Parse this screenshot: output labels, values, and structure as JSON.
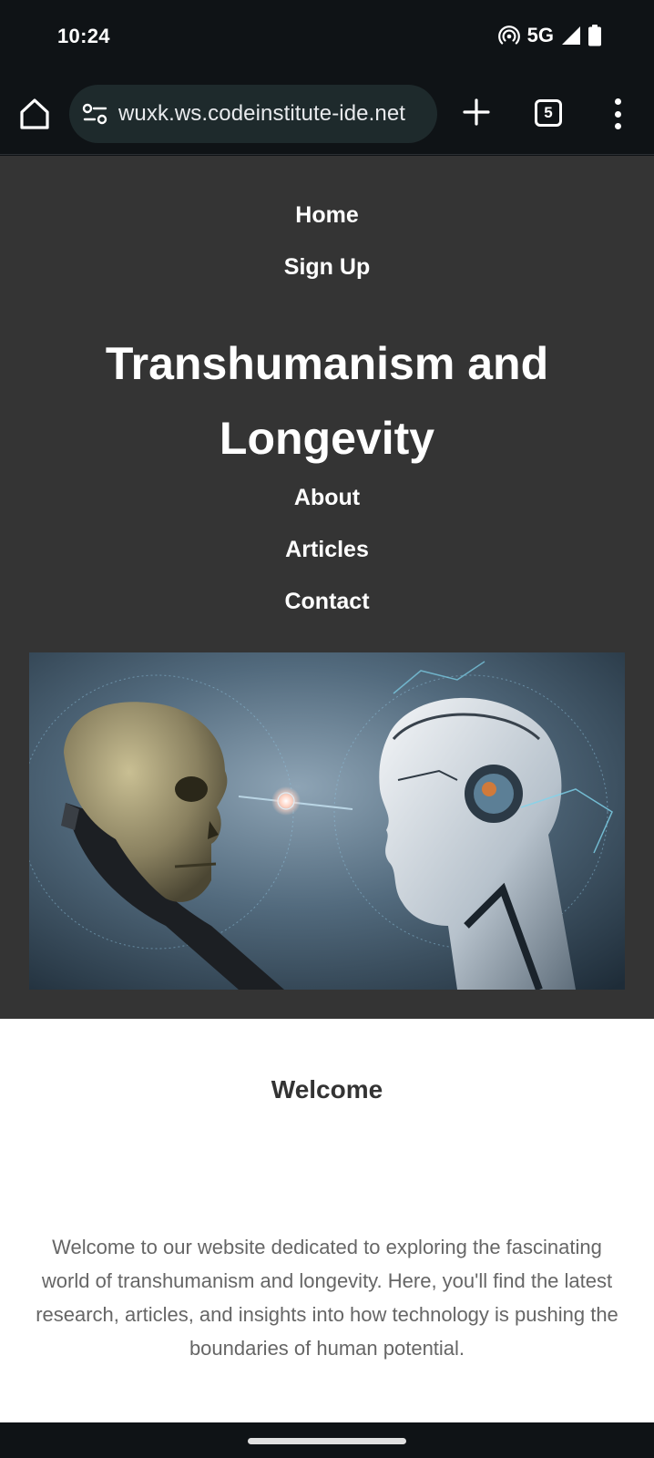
{
  "status_bar": {
    "time": "10:24",
    "network": "5G",
    "icons": [
      "hotspot-icon",
      "signal-icon",
      "battery-icon"
    ]
  },
  "browser": {
    "url": "wuxk.ws.codeinstitute-ide.net",
    "tab_count": "5",
    "icons": [
      "home-icon",
      "site-settings-icon",
      "new-tab-icon",
      "tabs-icon",
      "more-menu-icon"
    ]
  },
  "nav": {
    "home": "Home",
    "sign_up": "Sign Up",
    "about": "About",
    "articles": "Articles",
    "contact": "Contact"
  },
  "site": {
    "title": "Transhumanism and Longevity"
  },
  "welcome": {
    "heading": "Welcome",
    "text": "Welcome to our website dedicated to exploring the fascinating world of transhumanism and longevity. Here, you'll find the latest research, articles, and insights into how technology is pushing the boundaries of human potential."
  },
  "colors": {
    "header_bg": "#343434",
    "chrome_bg": "#0f1316",
    "omnibox_bg": "#1e2a2c",
    "heading_text": "#333333",
    "body_text": "#666666"
  }
}
